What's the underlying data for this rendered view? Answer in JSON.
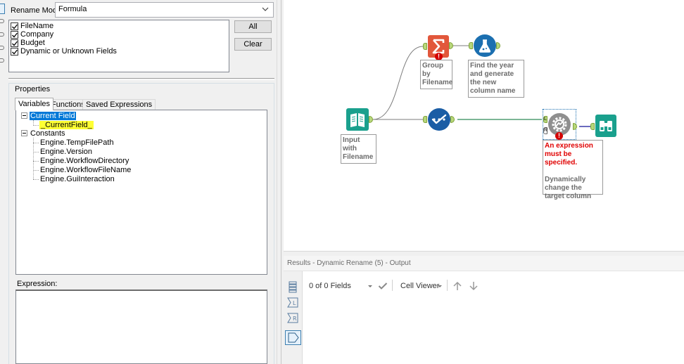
{
  "config": {
    "rename_mode_label": "Rename Mode:",
    "rename_mode_value": "Formula",
    "fields": [
      {
        "label": "FileName",
        "checked": true
      },
      {
        "label": "Company",
        "checked": true
      },
      {
        "label": "Budget",
        "checked": true
      },
      {
        "label": "Dynamic or Unknown Fields",
        "checked": true
      }
    ],
    "all_button": "All",
    "clear_button": "Clear",
    "properties_title": "Properties",
    "tabs": [
      "Variables",
      "Functions",
      "Saved Expressions"
    ],
    "tree": {
      "current_field": "Current Field",
      "current_field_var": "_CurrentField_",
      "constants": "Constants",
      "constant_items": [
        "Engine.TempFilePath",
        "Engine.Version",
        "Engine.WorkflowDirectory",
        "Engine.WorkflowFileName",
        "Engine.GuiInteraction"
      ]
    },
    "expression_label": "Expression:",
    "expression_value": ""
  },
  "canvas": {
    "tools": {
      "input_annotation": "Input with Filename",
      "summarize_annotation": "Group by Filename",
      "formula_annotation": "Find the year and generate the new column name",
      "rename_error": "An expression must be specified.",
      "rename_annotation": "Dynamically change the target column",
      "error_mark": "!",
      "anchor_l": "L",
      "anchor_r": "R"
    },
    "colors": {
      "input": "#1aa08d",
      "summarize": "#e2573b",
      "formula": "#1b6fb0",
      "select": "#1b5da5",
      "dynamic_rename": "#8f8f8f",
      "browse": "#1aa08d",
      "anchor": "#b7d77a",
      "error": "#d40000"
    }
  },
  "results": {
    "header": "Results - Dynamic Rename (5) - Output",
    "fields_count": "0 of 0 Fields",
    "cell_viewer": "Cell Viewer"
  }
}
